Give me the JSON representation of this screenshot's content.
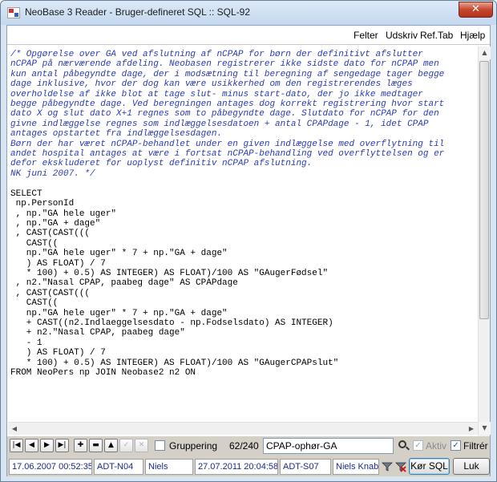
{
  "window": {
    "title": "NeoBase 3 Reader - Bruger-defineret SQL :: SQL-92",
    "close_label": "✕"
  },
  "menu": {
    "items": [
      "Felter",
      "Udskriv",
      "Ref.Tab",
      "Hjælp"
    ]
  },
  "editor": {
    "comment_lines": [
      "/* Opgørelse over GA ved afslutning af nCPAP for børn der definitivt afslutter",
      "nCPAP på nærværende afdeling. Neobasen registrerer ikke sidste dato for nCPAP men",
      "kun antal påbegyndte dage, der i modsætning til beregning af sengedage tager begge",
      "dage inklusive, hvor der dog kan være usikkerhed om den registrerendes læges",
      "overholdelse af ikke blot at tage slut- minus start-dato, der jo ikke medtager",
      "begge påbegyndte dage. Ved beregningen antages dog korrekt registrering hvor start",
      "dato X og slut dato X+1 regnes som to påbegyndte dage. Slutdato for nCPAP for den",
      "givne indlæggelse regnes som indlæggelsesdatoen + antal CPAPdage - 1, idet CPAP",
      "antages opstartet fra indlæggelsesdagen.",
      "Børn der har været nCPAP-behandlet under en given indlæggelse med overflytning til",
      "andet hospital antages at være i fortsat nCPAP-behandling ved overflyttelsen og er",
      "defor ekskluderet for uoplyst definitiv nCPAP afslutning.",
      "NK juni 2007. */"
    ],
    "code_lines": [
      "",
      "SELECT",
      " np.PersonId",
      " , np.\"GA hele uger\"",
      " , np.\"GA + dage\"",
      " , CAST(CAST(((",
      "   CAST((",
      "   np.\"GA hele uger\" * 7 + np.\"GA + dage\"",
      "   ) AS FLOAT) / 7",
      "   * 100) + 0.5) AS INTEGER) AS FLOAT)/100 AS \"GAugerFødsel\"",
      " , n2.\"Nasal CPAP, paabeg dage\" AS CPAPdage",
      " , CAST(CAST(((",
      "   CAST((",
      "   np.\"GA hele uger\" * 7 + np.\"GA + dage\"",
      "   + CAST((n2.Indlaeggelsesdato - np.Fodselsdato) AS INTEGER)",
      "   + n2.\"Nasal CPAP, paabeg dage\"",
      "   - 1",
      "   ) AS FLOAT) / 7",
      "   * 100) + 0.5) AS INTEGER) AS FLOAT)/100 AS \"GAugerCPAPslut\"",
      "FROM NeoPers np JOIN Neobase2 n2 ON"
    ]
  },
  "toolbar": {
    "grouping_label": "Gruppering",
    "record_counter": "62/240",
    "query_name": "CPAP-ophør-GA",
    "aktiv_label": "Aktiv",
    "filter_label": "Filtrér",
    "aktiv_checked": true,
    "filter_checked": true,
    "grouping_checked": false
  },
  "status": {
    "created": "17.06.2007 00:52:35",
    "created_by_code": "ADT-N04",
    "created_by": "Niels",
    "modified": "27.07.2011 20:04:58",
    "modified_by_code": "ADT-S07",
    "modified_by": "Niels Knab",
    "run_label": "Kør SQL",
    "close_label": "Luk"
  }
}
